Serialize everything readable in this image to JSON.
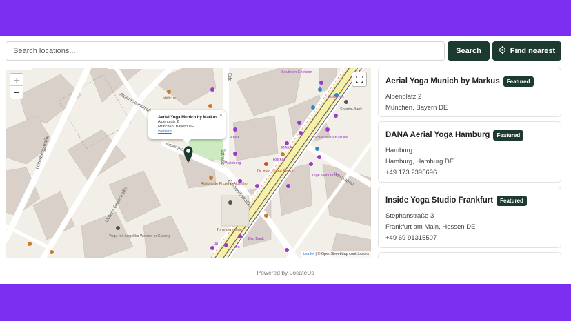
{
  "search": {
    "placeholder": "Search locations...",
    "search_button": "Search",
    "nearest_button": "Find nearest"
  },
  "map": {
    "zoom_in": "+",
    "zoom_out": "−",
    "popup": {
      "title": "Aerial Yoga Munich by Markus",
      "address": "Alpenplatz 2",
      "city": "München, Bayern DE",
      "link": "Website",
      "close": "×"
    },
    "attribution_leaflet": "Leaflet",
    "attribution_rest": "| © OpenStreetMap contributors",
    "street_labels": {
      "alpenrosenstrasse": "Alpenrosenstraße",
      "unterbergstrasse": "Unterbergstraße",
      "untere_grasstrasse": "Untere Grasstraße",
      "edelweissstrasse": "Edelweißstraße",
      "alpenplatz": "Alpenplatz",
      "watzmann": "Watzmann",
      "ede": "Ede",
      "sstrasse": "ßstraße"
    },
    "poi_labels": {
      "labiticus": "Labiticus",
      "southern_envision": "Southern Envision",
      "ostflower": "Ostflower",
      "sparda_bank": "Sparda-Bank",
      "schreibwaren_muller": "Schreibwaren Müller",
      "anick": "Anick",
      "maka": "MAKA",
      "rucker": "Rucker",
      "weinberg": "Weinberg",
      "dr_med_liane_becker": "Dr. med. Liane Becker",
      "inge_manufaktur": "Inge Manufaktur",
      "ristorante_pizzeria": "Ristorante Pizzeria Alpenhof",
      "torre_pendente": "Torre pendente",
      "yoga_angelika": "Yoga mit Angelika Wenzel in Giesing",
      "al": "AL",
      "dm": "dm",
      "dro_bank": "Dro Bank"
    }
  },
  "locations": [
    {
      "name": "Aerial Yoga Munich by Markus",
      "badge": "Featured",
      "address": "Alpenplatz 2",
      "city": "München, Bayern DE"
    },
    {
      "name": "DANA Aerial Yoga Hamburg",
      "badge": "Featured",
      "address": "Hamburg",
      "city": "Hamburg, Hamburg DE",
      "phone": "+49 173 2395696"
    },
    {
      "name": "Inside Yoga Studio Frankfurt",
      "badge": "Featured",
      "address": "Stephanstraße 3",
      "city": "Frankfurt am Main, Hessen DE",
      "phone": "+49 69 91315507"
    }
  ],
  "footer": "Powered by LocateUs",
  "colors": {
    "brand_purple": "#7c2ff0",
    "button_green": "#1d3a30",
    "map_background": "#f2efe9",
    "tram_yellow": "#f7f0a8"
  }
}
